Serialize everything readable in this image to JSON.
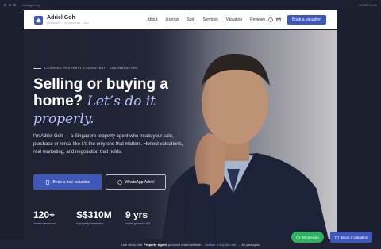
{
  "browser": {
    "url": "adrielgoh.sg",
    "corner": "SGBP Demo"
  },
  "brand": {
    "name": "Adriel Goh",
    "tagline": "PROPERTY · SINGAPORE · CEA"
  },
  "nav": {
    "links": [
      "About",
      "Listings",
      "Sold",
      "Services",
      "Valuation",
      "Reviews"
    ],
    "cta": "Book a valuation"
  },
  "hero": {
    "eyebrow": "LICENSED PROPERTY CONSULTANT · CEA SINGAPORE",
    "headline_plain": "Selling or buying a home?",
    "headline_italic": "Let’s do it properly.",
    "body": "I'm Adriel Goh — a Singapore property agent who treats your sale, purchase or rental like it's the only one that matters. Honest valuations, real marketing, and negotiation that holds.",
    "primary_button": "Book a free valuation",
    "secondary_button": "WhatsApp Adriel",
    "stats": [
      {
        "value": "120+",
        "label": "homes transacted"
      },
      {
        "value": "S$310M",
        "label": "in property transacted"
      },
      {
        "value": "9 yrs",
        "label": "on the ground in SG"
      }
    ]
  },
  "footer": {
    "prefix": "Live demo of a",
    "bold": "Property Agent",
    "middle": "personal brand website ·",
    "link": "License & buy this site →",
    "suffix": "All packages"
  },
  "floating": {
    "whatsapp": "WhatsApp",
    "book": "Book a valuation"
  },
  "colors": {
    "accent": "#3f57b8",
    "whatsapp": "#2db35e",
    "italic": "#b9c6ff"
  }
}
